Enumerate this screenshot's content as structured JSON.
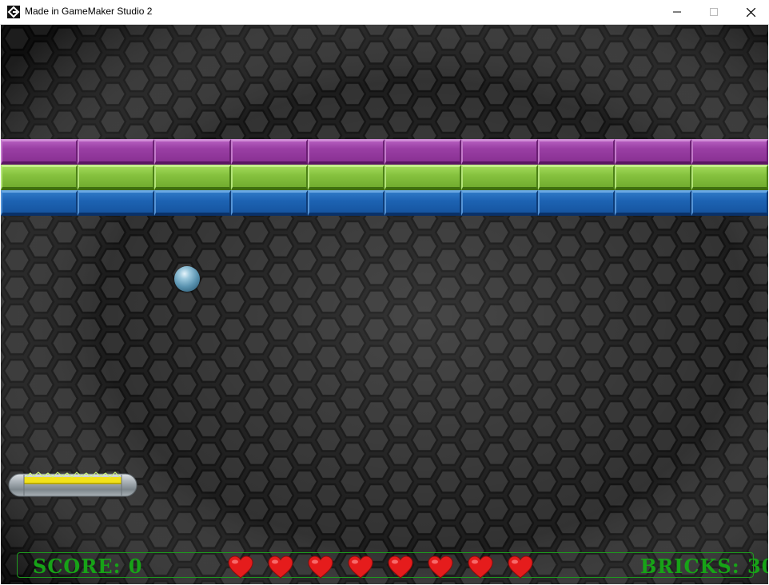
{
  "window": {
    "title": "Made in GameMaker Studio 2",
    "icon": "gamemaker-icon",
    "controls": [
      "minimize-icon",
      "maximize-icon",
      "close-icon"
    ]
  },
  "game": {
    "background": "dark-hexagon-mesh",
    "brick_rows": [
      {
        "color": "purple",
        "count": 10
      },
      {
        "color": "green",
        "count": 10
      },
      {
        "color": "blue",
        "count": 10
      }
    ],
    "colors": {
      "purple": "#9a3fa4",
      "green": "#86c23f",
      "blue": "#1d63b3",
      "hud_text": "#17a317",
      "heart": "#e51c1c"
    }
  },
  "hud": {
    "score_label": "SCORE:",
    "score_value": "0",
    "bricks_label": "BRICKS:",
    "bricks_value": "30",
    "lives": 8
  }
}
